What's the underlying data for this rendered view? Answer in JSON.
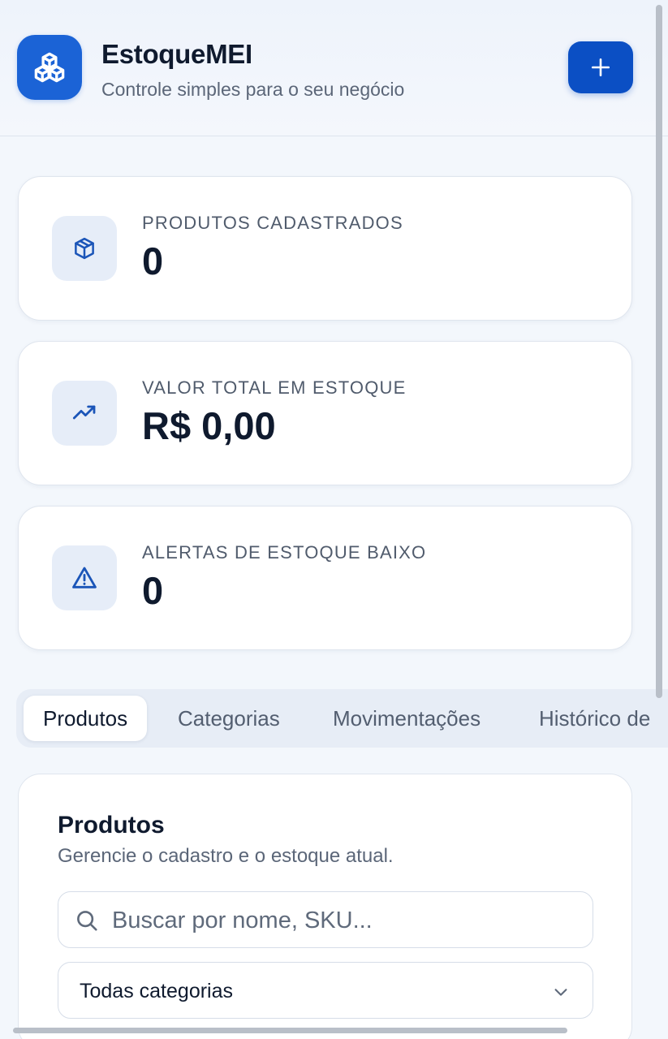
{
  "header": {
    "title": "EstoqueMEI",
    "subtitle": "Controle simples para o seu negócio",
    "logo_icon": "cubes-icon",
    "add_icon": "plus-icon"
  },
  "stats": [
    {
      "label": "PRODUTOS CADASTRADOS",
      "value": "0",
      "icon": "package-icon"
    },
    {
      "label": "VALOR TOTAL EM ESTOQUE",
      "value": "R$ 0,00",
      "icon": "trending-up-icon"
    },
    {
      "label": "ALERTAS DE ESTOQUE BAIXO",
      "value": "0",
      "icon": "alert-triangle-icon"
    }
  ],
  "tabs": [
    {
      "label": "Produtos",
      "active": true
    },
    {
      "label": "Categorias",
      "active": false
    },
    {
      "label": "Movimentações",
      "active": false
    },
    {
      "label": "Histórico de",
      "active": false
    }
  ],
  "products_panel": {
    "title": "Produtos",
    "description": "Gerencie o cadastro e o estoque atual.",
    "search_placeholder": "Buscar por nome, SKU...",
    "category_select": "Todas categorias"
  },
  "colors": {
    "accent": "#1b63d6",
    "button": "#0b4fc4",
    "background": "#f3f7fc"
  }
}
